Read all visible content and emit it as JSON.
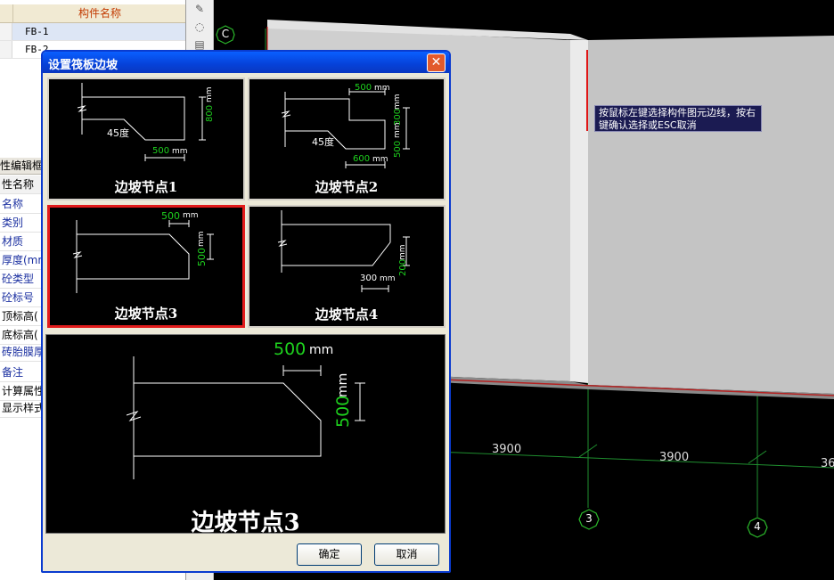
{
  "component_list": {
    "header": "构件名称",
    "rows": [
      "FB-1",
      "FB-2"
    ]
  },
  "property_editor": {
    "title": "性编辑框",
    "header": "性名称",
    "rows": [
      "名称",
      "类别",
      "材质",
      "厚度(mm)",
      "砼类型",
      "砼标号",
      "顶标高(",
      "底标高(",
      "砖胎膜厚",
      "备注",
      "计算属性",
      "显示样式"
    ]
  },
  "viewport": {
    "axis_labels": [
      "C",
      "3",
      "4"
    ],
    "dimensions": [
      "3900",
      "3900",
      "36"
    ],
    "tooltip": "按鼠标左键选择构件图元边线，按右键确认选择或ESC取消"
  },
  "dialog": {
    "title": "设置筏板边坡",
    "close_icon": "close-icon",
    "options": [
      {
        "label": "边坡节点1",
        "dims": [
          "800",
          "mm",
          "45度",
          "500",
          "mm"
        ]
      },
      {
        "label": "边坡节点2",
        "dims": [
          "500",
          "mm",
          "300",
          "mm",
          "45度",
          "500",
          "mm",
          "600",
          "mm"
        ]
      },
      {
        "label": "边坡节点3",
        "dims": [
          "500",
          "mm",
          "500",
          "mm"
        ]
      },
      {
        "label": "边坡节点4",
        "dims": [
          "200",
          "mm",
          "300",
          "mm"
        ]
      }
    ],
    "selected_index": 2,
    "preview": {
      "label": "边坡节点3",
      "dims": [
        "500",
        "mm",
        "500",
        "mm"
      ]
    },
    "ok_label": "确定",
    "cancel_label": "取消"
  },
  "colors": {
    "dim_green": "#1ed21e",
    "selection_red": "#e21c1c",
    "titlebar_blue": "#0641d8"
  }
}
